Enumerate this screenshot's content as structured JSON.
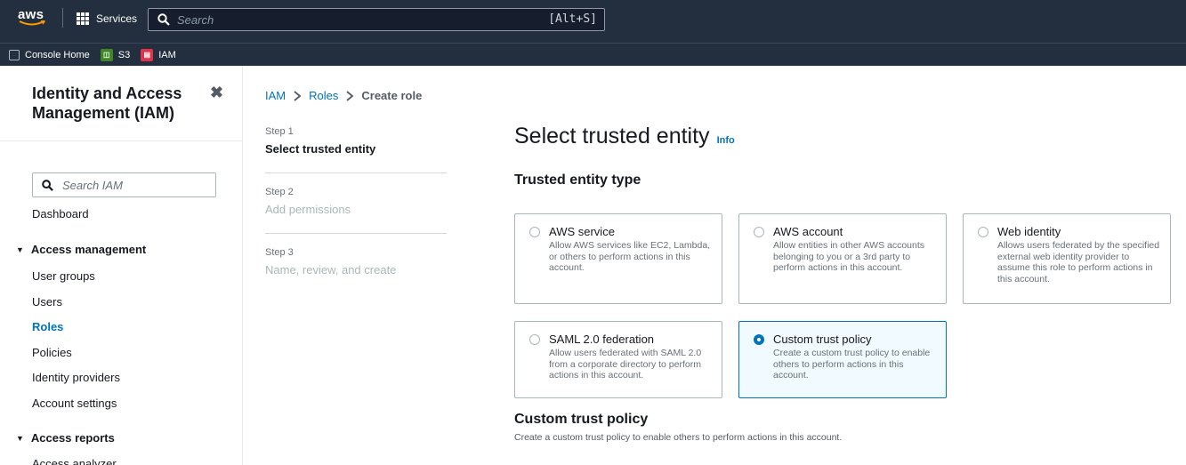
{
  "topnav": {
    "logo_text": "aws",
    "services_label": "Services",
    "search_placeholder": "Search",
    "search_shortcut": "[Alt+S]"
  },
  "favorites": [
    {
      "label": "Console Home",
      "icon": "cube-icon"
    },
    {
      "label": "S3",
      "icon": "s3-icon",
      "color": "#3f8624"
    },
    {
      "label": "IAM",
      "icon": "iam-icon",
      "color": "#dd344c"
    }
  ],
  "sidebar": {
    "title": "Identity and Access Management (IAM)",
    "close_label": "✖",
    "search_placeholder": "Search IAM",
    "dashboard": "Dashboard",
    "section_access_management": "Access management",
    "items": [
      "User groups",
      "Users",
      "Roles",
      "Policies",
      "Identity providers",
      "Account settings"
    ],
    "active_item": "Roles",
    "section_access_reports": "Access reports",
    "partial_item": "Access analyzer"
  },
  "breadcrumb": {
    "items": [
      "IAM",
      "Roles",
      "Create role"
    ]
  },
  "steps": [
    {
      "num": "Step 1",
      "label": "Select trusted entity"
    },
    {
      "num": "Step 2",
      "label": "Add permissions"
    },
    {
      "num": "Step 3",
      "label": "Name, review, and create"
    }
  ],
  "main": {
    "heading": "Select trusted entity",
    "info_link": "Info",
    "subheading": "Trusted entity type",
    "tiles": [
      {
        "title": "AWS service",
        "desc": "Allow AWS services like EC2, Lambda, or others to perform actions in this account.",
        "selected": false
      },
      {
        "title": "AWS account",
        "desc": "Allow entities in other AWS accounts belonging to you or a 3rd party to perform actions in this account.",
        "selected": false
      },
      {
        "title": "Web identity",
        "desc": "Allows users federated by the specified external web identity provider to assume this role to perform actions in this account.",
        "selected": false
      },
      {
        "title": "SAML 2.0 federation",
        "desc": "Allow users federated with SAML 2.0 from a corporate directory to perform actions in this account.",
        "selected": false
      },
      {
        "title": "Custom trust policy",
        "desc": "Create a custom trust policy to enable others to perform actions in this account.",
        "selected": true
      }
    ],
    "policy_heading": "Custom trust policy",
    "policy_desc": "Create a custom trust policy to enable others to perform actions in this account."
  },
  "colors": {
    "nav_bg": "#232f3e",
    "link": "#0073bb",
    "aws_orange": "#ff9900"
  }
}
